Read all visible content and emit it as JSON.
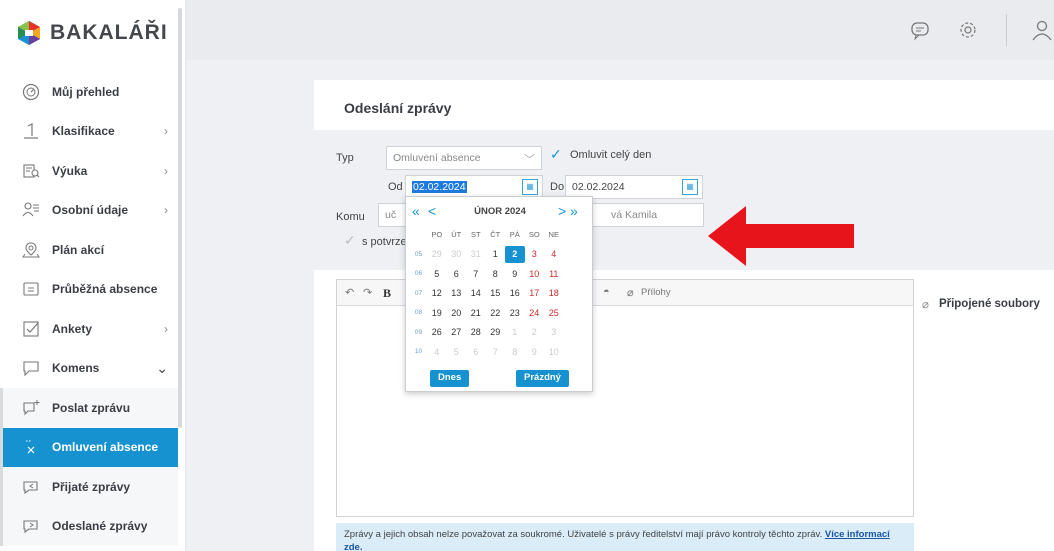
{
  "brand": "BAKALÁŘI",
  "sidebar": {
    "items": [
      {
        "label": "Můj přehled",
        "icon": "gauge-icon",
        "chevron": false
      },
      {
        "label": "Klasifikace",
        "icon": "grade-one-icon",
        "chevron": true
      },
      {
        "label": "Výuka",
        "icon": "book-search-icon",
        "chevron": true
      },
      {
        "label": "Osobní údaje",
        "icon": "person-list-icon",
        "chevron": true
      },
      {
        "label": "Plán akcí",
        "icon": "map-pin-icon",
        "chevron": false
      },
      {
        "label": "Průběžná absence",
        "icon": "absence-card-icon",
        "chevron": false
      },
      {
        "label": "Ankety",
        "icon": "checkbox-icon",
        "chevron": true
      },
      {
        "label": "Komens",
        "icon": "chat-bubble-icon",
        "chevron": "down"
      }
    ],
    "subitems": [
      {
        "label": "Poslat zprávu",
        "icon": "message-plus-icon"
      },
      {
        "label": "Omluvení absence",
        "icon": "excuse-icon",
        "active": true
      },
      {
        "label": "Přijaté zprávy",
        "icon": "message-in-icon"
      },
      {
        "label": "Odeslané zprávy",
        "icon": "message-out-icon"
      }
    ]
  },
  "topbar": {
    "icons": [
      "message-icon",
      "gear-icon",
      "user-icon"
    ]
  },
  "form": {
    "title": "Odeslání zprávy",
    "typ_label": "Typ",
    "typ_value": "Omluvení absence",
    "full_day_label": "Omluvit celý den",
    "od_label": "Od",
    "od_value": "02.02.2024",
    "do_label": "Do",
    "do_value": "02.02.2024",
    "komu_label": "Komu",
    "komu_prefix": "uč",
    "komu_suffix": "vá Kamila",
    "confirm_label": "s potvrze"
  },
  "editor": {
    "bold": "B",
    "attachments": "Přílohy",
    "attached_files": "Připojené soubory"
  },
  "notice": {
    "text": "Zprávy a jejich obsah nelze považovat za soukromé. Uživatelé s právy ředitelství mají právo kontroly těchto zpráv.",
    "link": "Více informací",
    "link2": "zde."
  },
  "datepicker": {
    "month": "ÚNOR 2024",
    "prev_year": "«",
    "prev": "<",
    "next": ">",
    "next_year": "»",
    "weekdays": [
      "PO",
      "ÚT",
      "ST",
      "ČT",
      "PÁ",
      "SO",
      "NE"
    ],
    "weeks": [
      {
        "wk": "05",
        "days": [
          "29",
          "30",
          "31",
          "1",
          "2",
          "3",
          "4"
        ]
      },
      {
        "wk": "06",
        "days": [
          "5",
          "6",
          "7",
          "8",
          "9",
          "10",
          "11"
        ]
      },
      {
        "wk": "07",
        "days": [
          "12",
          "13",
          "14",
          "15",
          "16",
          "17",
          "18"
        ]
      },
      {
        "wk": "08",
        "days": [
          "19",
          "20",
          "21",
          "22",
          "23",
          "24",
          "25"
        ]
      },
      {
        "wk": "09",
        "days": [
          "26",
          "27",
          "28",
          "29",
          "1",
          "2",
          "3"
        ]
      },
      {
        "wk": "10",
        "days": [
          "4",
          "5",
          "6",
          "7",
          "8",
          "9",
          "10"
        ]
      }
    ],
    "today_button": "Dnes",
    "clear_button": "Prázdný"
  },
  "annotation": {
    "color": "#e8141b"
  }
}
